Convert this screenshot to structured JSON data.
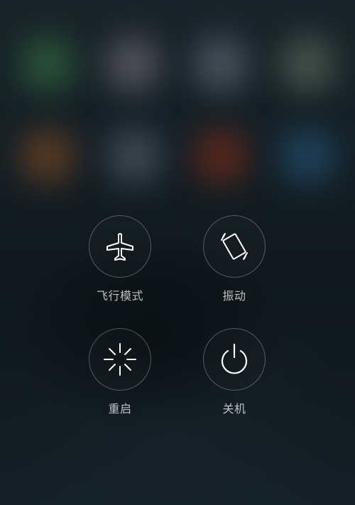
{
  "power_menu": {
    "actions": [
      {
        "id": "airplane",
        "label": "飞行模式",
        "icon": "airplane-icon"
      },
      {
        "id": "vibrate",
        "label": "振动",
        "icon": "vibrate-icon"
      },
      {
        "id": "reboot",
        "label": "重启",
        "icon": "reboot-icon"
      },
      {
        "id": "power-off",
        "label": "关机",
        "icon": "power-icon"
      }
    ]
  },
  "background": {
    "blurred_app_icon_colors": [
      "#2e5c3c",
      "#5a5b62",
      "#4e5a66",
      "#4e5a52",
      "#6a4428",
      "#4c5560",
      "#6a2c1e",
      "#234e6c"
    ]
  },
  "colors": {
    "icon_stroke": "#ffffff",
    "label": "#c8cbcd"
  }
}
